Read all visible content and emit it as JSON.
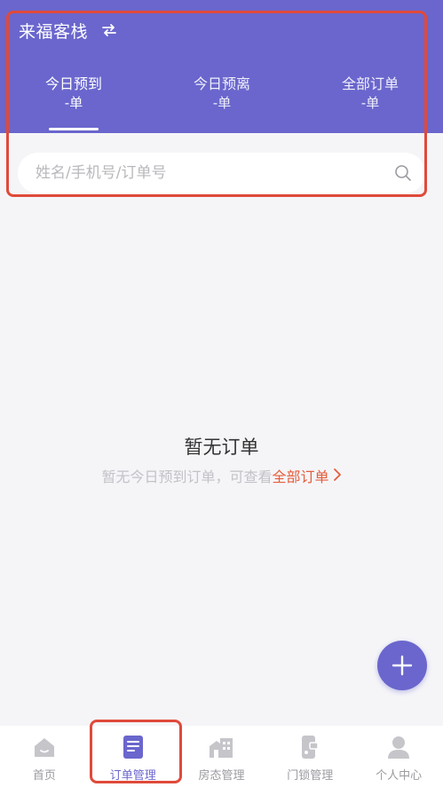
{
  "header": {
    "hotel_name": "来福客栈",
    "switch_icon": "switch-icon",
    "background": "#6a66cd"
  },
  "tabs": [
    {
      "label": "今日预到",
      "count": "-单",
      "active": true
    },
    {
      "label": "今日预离",
      "count": "-单",
      "active": false
    },
    {
      "label": "全部订单",
      "count": "-单",
      "active": false
    }
  ],
  "search": {
    "placeholder": "姓名/手机号/订单号",
    "value": "",
    "icon": "search-icon"
  },
  "empty_state": {
    "title": "暂无订单",
    "subtitle": "暂无今日预到订单，可查看",
    "link": "全部订单",
    "link_color": "#e45d3c"
  },
  "fab": {
    "icon": "plus-icon"
  },
  "bottom_nav": [
    {
      "label": "首页",
      "icon": "home-icon",
      "active": false
    },
    {
      "label": "订单管理",
      "icon": "order-icon",
      "active": true
    },
    {
      "label": "房态管理",
      "icon": "building-icon",
      "active": false
    },
    {
      "label": "门锁管理",
      "icon": "door-lock-icon",
      "active": false
    },
    {
      "label": "个人中心",
      "icon": "user-icon",
      "active": false
    }
  ],
  "colors": {
    "accent": "#6a66cd",
    "annotation": "#e04a3a"
  }
}
